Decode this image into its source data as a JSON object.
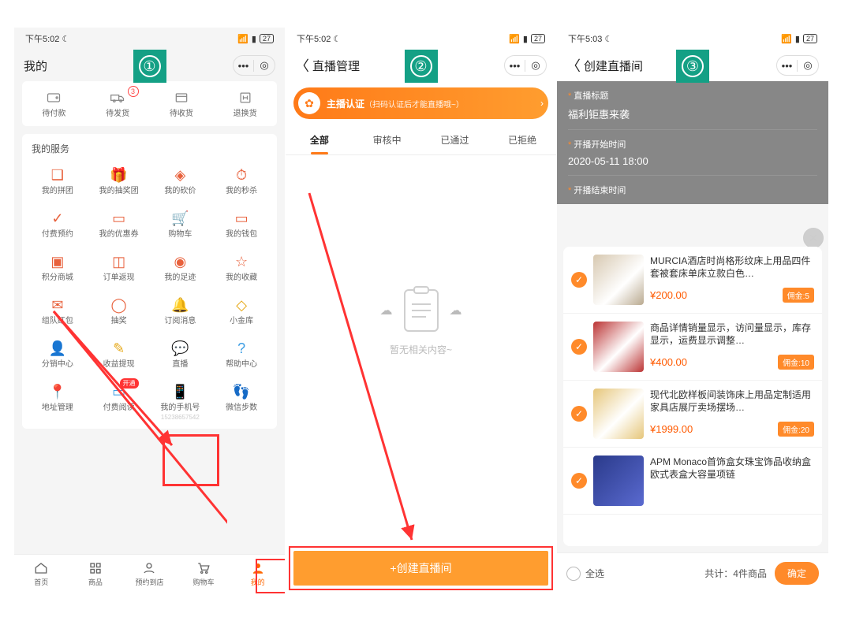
{
  "screen1": {
    "step": "①",
    "status": {
      "time": "下午5:02",
      "battery": "27"
    },
    "head_title": "我的",
    "orders": [
      {
        "label": "待付款",
        "icon": "wallet"
      },
      {
        "label": "待发货",
        "icon": "truck",
        "badge": "3"
      },
      {
        "label": "待收货",
        "icon": "package"
      },
      {
        "label": "退换货",
        "icon": "refund"
      }
    ],
    "services_title": "我的服务",
    "services": [
      {
        "label": "我的拼团",
        "color": ""
      },
      {
        "label": "我的抽奖团",
        "color": ""
      },
      {
        "label": "我的砍价",
        "color": ""
      },
      {
        "label": "我的秒杀",
        "color": ""
      },
      {
        "label": "付费预约",
        "color": ""
      },
      {
        "label": "我的优惠券",
        "color": ""
      },
      {
        "label": "购物车",
        "color": ""
      },
      {
        "label": "我的钱包",
        "color": ""
      },
      {
        "label": "积分商城",
        "color": ""
      },
      {
        "label": "订单返现",
        "color": ""
      },
      {
        "label": "我的足迹",
        "color": ""
      },
      {
        "label": "我的收藏",
        "color": ""
      },
      {
        "label": "组队红包",
        "color": ""
      },
      {
        "label": "抽奖",
        "color": ""
      },
      {
        "label": "订阅消息",
        "color": ""
      },
      {
        "label": "小金库",
        "color": "yellow"
      },
      {
        "label": "分销中心",
        "color": "yellow"
      },
      {
        "label": "收益提现",
        "color": "yellow"
      },
      {
        "label": "直播",
        "color": "blue"
      },
      {
        "label": "帮助中心",
        "color": "blue"
      },
      {
        "label": "地址管理",
        "color": "blue"
      },
      {
        "label": "付费阅读",
        "color": "blue",
        "badge": "开通"
      },
      {
        "label": "我的手机号",
        "color": "blue",
        "sub": "15238657542"
      },
      {
        "label": "微信步数",
        "color": "blue"
      }
    ],
    "tabs": [
      {
        "label": "首页"
      },
      {
        "label": "商品"
      },
      {
        "label": "预约到店"
      },
      {
        "label": "购物车"
      },
      {
        "label": "我的"
      }
    ]
  },
  "screen2": {
    "step": "②",
    "status": {
      "time": "下午5:02",
      "battery": "27"
    },
    "head_title": "直播管理",
    "banner": {
      "title": "主播认证",
      "sub": "（扫码认证后才能直播哦~）"
    },
    "segments": [
      "全部",
      "审核中",
      "已通过",
      "已拒绝"
    ],
    "empty": "暂无相关内容~",
    "create_btn": "+创建直播间"
  },
  "screen3": {
    "step": "③",
    "status": {
      "time": "下午5:03",
      "battery": "27"
    },
    "head_title": "创建直播间",
    "form": {
      "title_label": "直播标题",
      "title_value": "福利钜惠来袭",
      "start_label": "开播开始时间",
      "start_value": "2020-05-11    18:00",
      "end_label": "开播结束时间"
    },
    "products": [
      {
        "title": "MURCIA酒店时尚格形纹床上用品四件套被套床单床立款白色…",
        "price": "¥200.00",
        "commission": "佣金:5"
      },
      {
        "title": "商品详情销量显示，访问量显示，库存显示，运费显示调整…",
        "price": "¥400.00",
        "commission": "佣金:10"
      },
      {
        "title": "现代北欧样板间装饰床上用品定制适用家具店展厅卖场摆场…",
        "price": "¥1999.00",
        "commission": "佣金:20"
      },
      {
        "title": "APM Monaco首饰盒女珠宝饰品收纳盒欧式表盒大容量项链",
        "price": "",
        "commission": ""
      }
    ],
    "footer": {
      "all": "全选",
      "count": "共计：4件商品",
      "ok": "确定"
    }
  }
}
